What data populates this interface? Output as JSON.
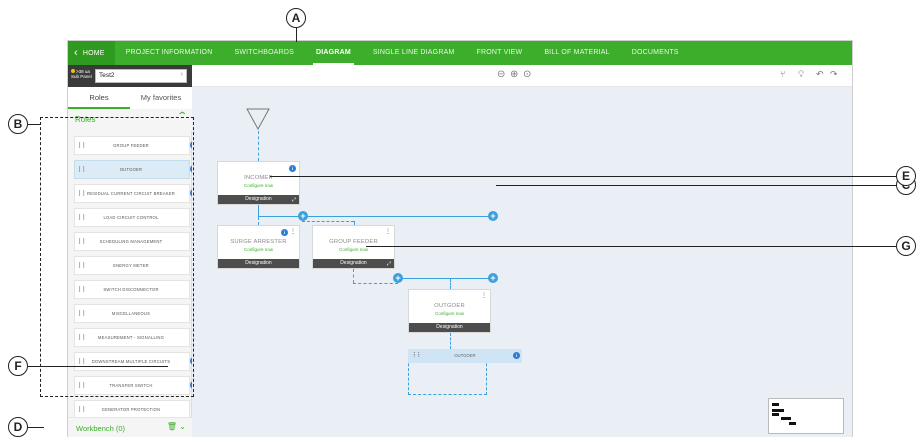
{
  "callouts": {
    "a": "A",
    "b": "B",
    "c": "C",
    "d": "D",
    "e": "E",
    "f": "F",
    "g": "G"
  },
  "nav": {
    "home": "HOME",
    "items": [
      "PROJECT INFORMATION",
      "SWITCHBOARDS",
      "DIAGRAM",
      "SINGLE LINE DIAGRAM",
      "FRONT VIEW",
      "BILL OF MATERIAL",
      "DOCUMENTS"
    ],
    "active": "DIAGRAM"
  },
  "project": {
    "badge_value": ">38 ua",
    "badge_sub": "Sub Panel",
    "name": "Test2"
  },
  "sidebar": {
    "tabs": [
      "Roles",
      "My favorites"
    ],
    "roles_title": "Roles",
    "roles": [
      {
        "label": "GROUP FEEDER"
      },
      {
        "label": "OUTGOER"
      },
      {
        "label": "RESIDUAL CURRENT CIRCUIT BREAKER"
      },
      {
        "label": "LOAD CIRCUIT CONTROL"
      },
      {
        "label": "SCHEDULING MANAGEMENT"
      },
      {
        "label": "ENERGY METER"
      },
      {
        "label": "SWITCH DISCONNECTOR"
      },
      {
        "label": "MISCELLANEOUS"
      },
      {
        "label": "MEASUREMENT - SIGNALLING"
      },
      {
        "label": "DOWNSTREAM MULTIPLE CIRCUITS"
      },
      {
        "label": "TRANSFER SWITCH"
      },
      {
        "label": "GENERATOR PROTECTION"
      }
    ],
    "workbench": "Workbench (0)"
  },
  "diagram": {
    "incomer": {
      "title": "INCOMER",
      "configure": "Configure now",
      "footer": "Designation"
    },
    "surge": {
      "title": "SURGE ARRESTER",
      "configure": "Configure now",
      "footer": "Designation"
    },
    "group_feeder": {
      "title": "GROUP FEEDER",
      "configure": "Configure now",
      "footer": "Designation"
    },
    "outgoer": {
      "title": "OUTGOER",
      "configure": "Configure now",
      "footer": "Designation"
    },
    "ghost": {
      "label": "OUTGOER"
    }
  },
  "colors": {
    "nav_green": "#3dae2b",
    "wire_blue": "#3aa0de",
    "info_blue": "#2e7bcf",
    "selected_row": "#dcecf7"
  }
}
